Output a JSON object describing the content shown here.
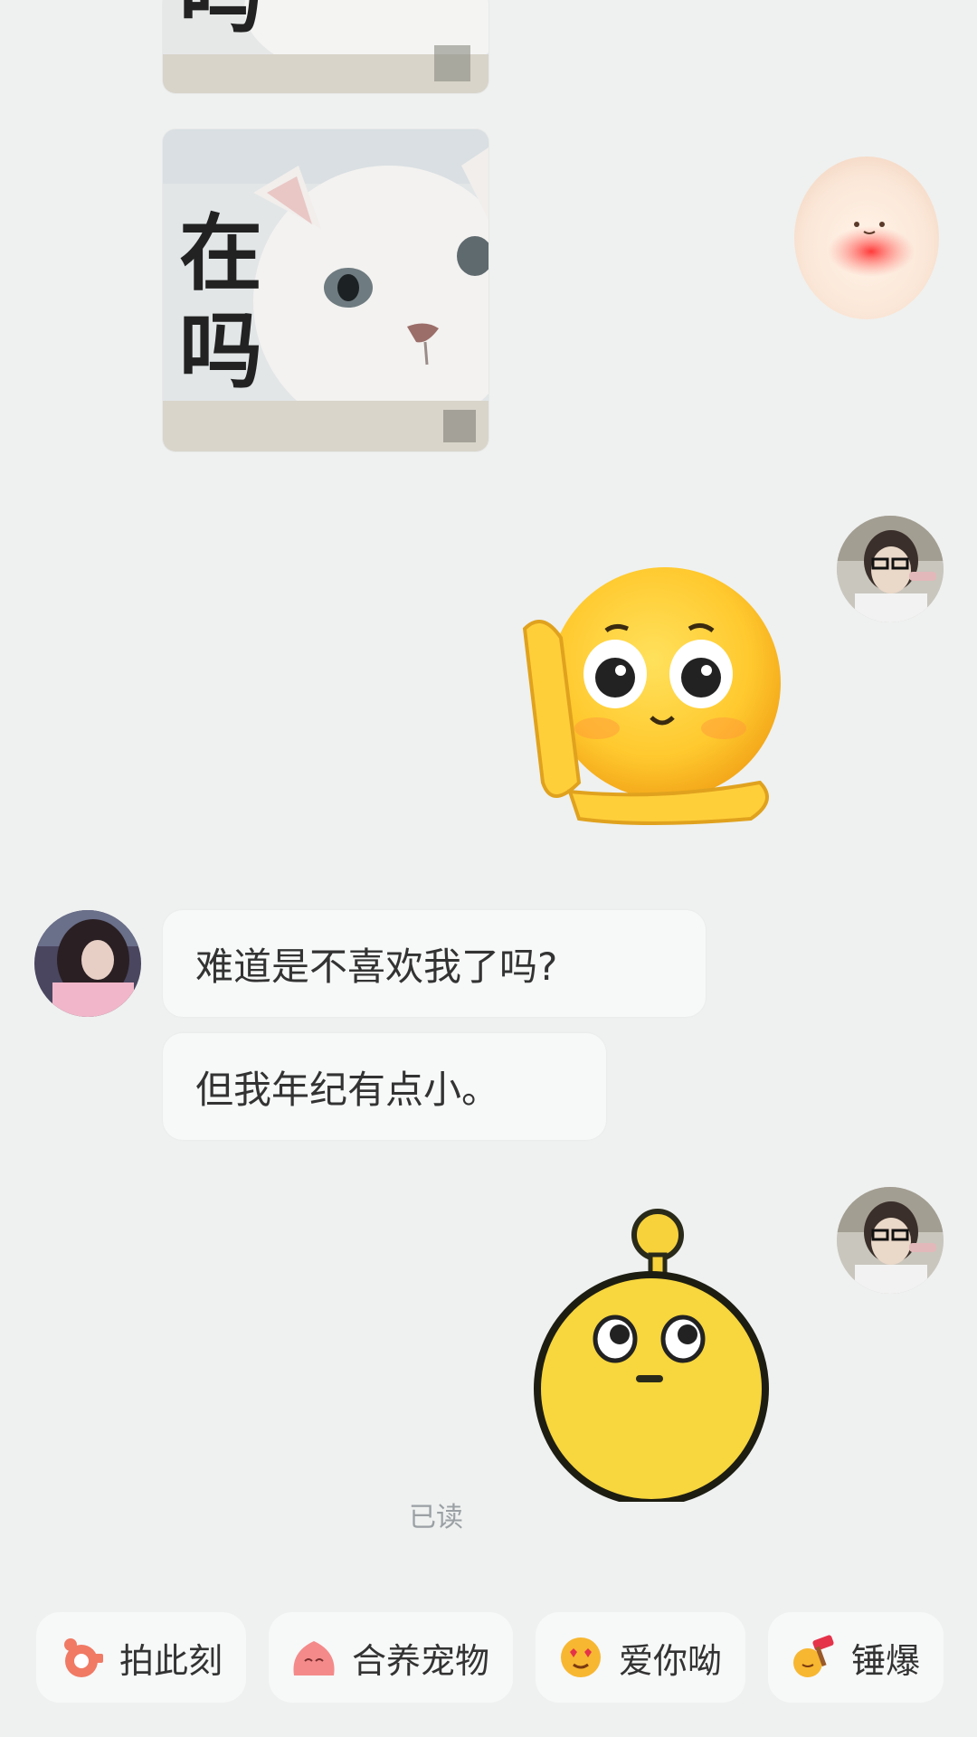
{
  "stickers": {
    "cat_top_text": "吗",
    "cat_main_line1": "在",
    "cat_main_line2": "吗"
  },
  "messages": [
    {
      "text": "难道是不喜欢我了吗?"
    },
    {
      "text": "但我年纪有点小。"
    }
  ],
  "status": {
    "read": "已读"
  },
  "suggestions": [
    {
      "label": "拍此刻",
      "icon": "camera-icon",
      "color": "#f07a64"
    },
    {
      "label": "合养宠物",
      "icon": "pet-blob-icon",
      "color": "#f48a8a"
    },
    {
      "label": "爱你呦",
      "icon": "heart-eyes-emoji-icon",
      "color": "#f7b731"
    },
    {
      "label": "锤爆",
      "icon": "hammer-emoji-icon",
      "color": "#f28c28"
    }
  ]
}
